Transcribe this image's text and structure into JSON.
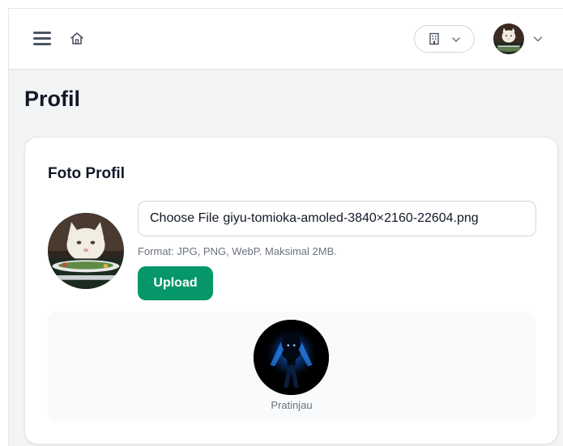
{
  "page": {
    "title": "Profil"
  },
  "profile_photo": {
    "heading": "Foto Profil",
    "file_input": {
      "button_label": "Choose File",
      "file_name": "giyu-tomioka-amoled-3840×2160-22604.png"
    },
    "hint": "Format: JPG, PNG, WebP. Maksimal 2MB.",
    "upload_label": "Upload",
    "preview_label": "Pratinjau"
  },
  "colors": {
    "primary": "#059669",
    "page_background": "#f3f4f6",
    "card_background": "#ffffff",
    "muted_text": "#6b7280"
  },
  "icons": {
    "menu": "hamburger-icon",
    "home": "home-icon",
    "organization": "building-icon",
    "dropdown": "chevron-down-icon"
  }
}
